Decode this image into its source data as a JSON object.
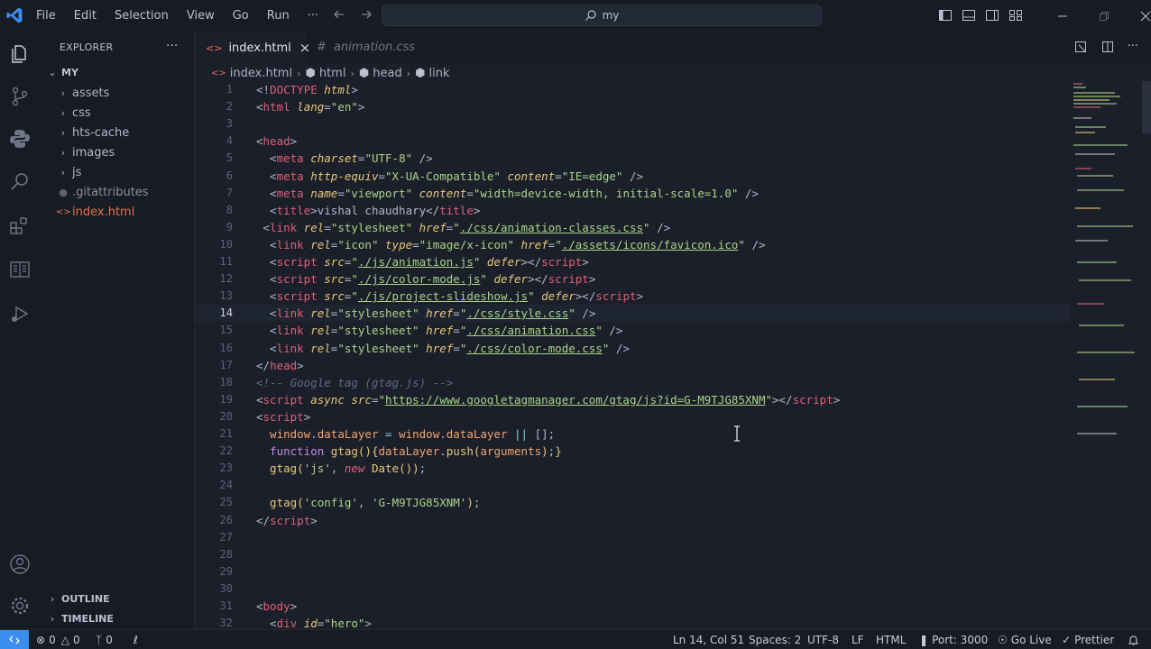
{
  "titlebar": {
    "menu": [
      "File",
      "Edit",
      "Selection",
      "View",
      "Go",
      "Run",
      "···"
    ],
    "search_text": "my"
  },
  "sidebar": {
    "title": "EXPLORER",
    "more": "···",
    "root": "MY",
    "items": [
      {
        "label": "assets",
        "type": "folder"
      },
      {
        "label": "css",
        "type": "folder"
      },
      {
        "label": "hts-cache",
        "type": "folder"
      },
      {
        "label": "images",
        "type": "folder"
      },
      {
        "label": "js",
        "type": "folder"
      },
      {
        "label": ".gitattributes",
        "type": "file"
      },
      {
        "label": "index.html",
        "type": "html"
      }
    ],
    "outline": "OUTLINE",
    "timeline": "TIMELINE"
  },
  "tabs": [
    {
      "label": "index.html",
      "icon": "html-icon",
      "active": true
    },
    {
      "label": "animation.css",
      "icon": "hash-icon",
      "active": false
    }
  ],
  "breadcrumb": [
    "index.html",
    "html",
    "head",
    "link"
  ],
  "editor": {
    "current_line": 14,
    "lines": [
      [
        [
          "t",
          "<!"
        ],
        [
          "tg",
          "DOCTYPE"
        ],
        [
          "t",
          " "
        ],
        [
          "at",
          "html"
        ],
        [
          "t",
          ">"
        ]
      ],
      [
        [
          "t",
          "<"
        ],
        [
          "tg",
          "html"
        ],
        [
          "t",
          " "
        ],
        [
          "at",
          "lang"
        ],
        [
          "t",
          "="
        ],
        [
          "sv",
          "\"en\""
        ],
        [
          "t",
          ">"
        ]
      ],
      [],
      [
        [
          "t",
          "<"
        ],
        [
          "tg",
          "head"
        ],
        [
          "t",
          ">"
        ]
      ],
      [
        [
          "t",
          "  <"
        ],
        [
          "tg",
          "meta"
        ],
        [
          "t",
          " "
        ],
        [
          "at",
          "charset"
        ],
        [
          "t",
          "="
        ],
        [
          "sv",
          "\"UTF-8\""
        ],
        [
          "t",
          " />"
        ]
      ],
      [
        [
          "t",
          "  <"
        ],
        [
          "tg",
          "meta"
        ],
        [
          "t",
          " "
        ],
        [
          "at",
          "http-equiv"
        ],
        [
          "t",
          "="
        ],
        [
          "sv",
          "\"X-UA-Compatible\""
        ],
        [
          "t",
          " "
        ],
        [
          "at",
          "content"
        ],
        [
          "t",
          "="
        ],
        [
          "sv",
          "\"IE=edge\""
        ],
        [
          "t",
          " />"
        ]
      ],
      [
        [
          "t",
          "  <"
        ],
        [
          "tg",
          "meta"
        ],
        [
          "t",
          " "
        ],
        [
          "at",
          "name"
        ],
        [
          "t",
          "="
        ],
        [
          "sv",
          "\"viewport\""
        ],
        [
          "t",
          " "
        ],
        [
          "at",
          "content"
        ],
        [
          "t",
          "="
        ],
        [
          "sv",
          "\"width=device-width, initial-scale=1.0\""
        ],
        [
          "t",
          " />"
        ]
      ],
      [
        [
          "t",
          "  <"
        ],
        [
          "tg",
          "title"
        ],
        [
          "t",
          ">vishal chaudhary</"
        ],
        [
          "tg",
          "title"
        ],
        [
          "t",
          ">"
        ]
      ],
      [
        [
          "t",
          " <"
        ],
        [
          "tg",
          "link"
        ],
        [
          "t",
          " "
        ],
        [
          "at",
          "rel"
        ],
        [
          "t",
          "="
        ],
        [
          "sv",
          "\"stylesheet\""
        ],
        [
          "t",
          " "
        ],
        [
          "at",
          "href"
        ],
        [
          "t",
          "="
        ],
        [
          "sv",
          "\""
        ],
        [
          "svu",
          "./css/animation-classes.css"
        ],
        [
          "sv",
          "\""
        ],
        [
          "t",
          " />"
        ]
      ],
      [
        [
          "t",
          "  <"
        ],
        [
          "tg",
          "link"
        ],
        [
          "t",
          " "
        ],
        [
          "at",
          "rel"
        ],
        [
          "t",
          "="
        ],
        [
          "sv",
          "\"icon\""
        ],
        [
          "t",
          " "
        ],
        [
          "at",
          "type"
        ],
        [
          "t",
          "="
        ],
        [
          "sv",
          "\"image/x-icon\""
        ],
        [
          "t",
          " "
        ],
        [
          "at",
          "href"
        ],
        [
          "t",
          "="
        ],
        [
          "sv",
          "\""
        ],
        [
          "svu",
          "./assets/icons/favicon.ico"
        ],
        [
          "sv",
          "\""
        ],
        [
          "t",
          " />"
        ]
      ],
      [
        [
          "t",
          "  <"
        ],
        [
          "tg",
          "script"
        ],
        [
          "t",
          " "
        ],
        [
          "at",
          "src"
        ],
        [
          "t",
          "="
        ],
        [
          "sv",
          "\""
        ],
        [
          "svu",
          "./js/animation.js"
        ],
        [
          "sv",
          "\""
        ],
        [
          "t",
          " "
        ],
        [
          "at",
          "defer"
        ],
        [
          "t",
          "></"
        ],
        [
          "tg",
          "script"
        ],
        [
          "t",
          ">"
        ]
      ],
      [
        [
          "t",
          "  <"
        ],
        [
          "tg",
          "script"
        ],
        [
          "t",
          " "
        ],
        [
          "at",
          "src"
        ],
        [
          "t",
          "="
        ],
        [
          "sv",
          "\""
        ],
        [
          "svu",
          "./js/color-mode.js"
        ],
        [
          "sv",
          "\""
        ],
        [
          "t",
          " "
        ],
        [
          "at",
          "defer"
        ],
        [
          "t",
          "></"
        ],
        [
          "tg",
          "script"
        ],
        [
          "t",
          ">"
        ]
      ],
      [
        [
          "t",
          "  <"
        ],
        [
          "tg",
          "script"
        ],
        [
          "t",
          " "
        ],
        [
          "at",
          "src"
        ],
        [
          "t",
          "="
        ],
        [
          "sv",
          "\""
        ],
        [
          "svu",
          "./js/project-slideshow.js"
        ],
        [
          "sv",
          "\""
        ],
        [
          "t",
          " "
        ],
        [
          "at",
          "defer"
        ],
        [
          "t",
          "></"
        ],
        [
          "tg",
          "script"
        ],
        [
          "t",
          ">"
        ]
      ],
      [
        [
          "t",
          "  <"
        ],
        [
          "tg",
          "link"
        ],
        [
          "t",
          " "
        ],
        [
          "at",
          "rel"
        ],
        [
          "t",
          "="
        ],
        [
          "sv",
          "\"stylesheet\""
        ],
        [
          "t",
          " "
        ],
        [
          "at",
          "href"
        ],
        [
          "t",
          "="
        ],
        [
          "sv",
          "\""
        ],
        [
          "svu",
          "./css/style.css"
        ],
        [
          "sv",
          "\""
        ],
        [
          "t",
          " />"
        ]
      ],
      [
        [
          "t",
          "  <"
        ],
        [
          "tg",
          "link"
        ],
        [
          "t",
          " "
        ],
        [
          "at",
          "rel"
        ],
        [
          "t",
          "="
        ],
        [
          "sv",
          "\"stylesheet\""
        ],
        [
          "t",
          " "
        ],
        [
          "at",
          "href"
        ],
        [
          "t",
          "="
        ],
        [
          "sv",
          "\""
        ],
        [
          "svu",
          "./css/animation.css"
        ],
        [
          "sv",
          "\""
        ],
        [
          "t",
          " />"
        ]
      ],
      [
        [
          "t",
          "  <"
        ],
        [
          "tg",
          "link"
        ],
        [
          "t",
          " "
        ],
        [
          "at",
          "rel"
        ],
        [
          "t",
          "="
        ],
        [
          "sv",
          "\"stylesheet\""
        ],
        [
          "t",
          " "
        ],
        [
          "at",
          "href"
        ],
        [
          "t",
          "="
        ],
        [
          "sv",
          "\""
        ],
        [
          "svu",
          "./css/color-mode.css"
        ],
        [
          "sv",
          "\""
        ],
        [
          "t",
          " />"
        ]
      ],
      [
        [
          "t",
          "</"
        ],
        [
          "tg",
          "head"
        ],
        [
          "t",
          ">"
        ]
      ],
      [
        [
          "cm",
          "<!-- Google tag (gtag.js) -->"
        ]
      ],
      [
        [
          "t",
          "<"
        ],
        [
          "tg",
          "script"
        ],
        [
          "t",
          " "
        ],
        [
          "at",
          "async"
        ],
        [
          "t",
          " "
        ],
        [
          "at",
          "src"
        ],
        [
          "t",
          "="
        ],
        [
          "sv",
          "\""
        ],
        [
          "svu",
          "https://www.googletagmanager.com/gtag/js?id=G-M9TJG85XNM"
        ],
        [
          "sv",
          "\""
        ],
        [
          "t",
          "></"
        ],
        [
          "tg",
          "script"
        ],
        [
          "t",
          ">"
        ]
      ],
      [
        [
          "t",
          "<"
        ],
        [
          "tg",
          "script"
        ],
        [
          "t",
          ">"
        ]
      ],
      [
        [
          "vr",
          "  window"
        ],
        [
          "t",
          "."
        ],
        [
          "vr",
          "dataLayer"
        ],
        [
          "op",
          " = "
        ],
        [
          "vr",
          "window"
        ],
        [
          "t",
          "."
        ],
        [
          "vr",
          "dataLayer"
        ],
        [
          "op",
          " || "
        ],
        [
          "t",
          "[];"
        ]
      ],
      [
        [
          "kw",
          "  function"
        ],
        [
          "t",
          " "
        ],
        [
          "fn",
          "gtag"
        ],
        [
          "br",
          "()"
        ],
        [
          "br",
          "{"
        ],
        [
          "vr",
          "dataLayer"
        ],
        [
          "t",
          "."
        ],
        [
          "fn",
          "push"
        ],
        [
          "br",
          "("
        ],
        [
          "vr",
          "arguments"
        ],
        [
          "br",
          ")"
        ],
        [
          "t",
          ";"
        ],
        [
          "br",
          "}"
        ]
      ],
      [
        [
          "fn",
          "  gtag"
        ],
        [
          "br",
          "("
        ],
        [
          "sv",
          "'js'"
        ],
        [
          "t",
          ", "
        ],
        [
          "nw",
          "new"
        ],
        [
          "t",
          " "
        ],
        [
          "fn",
          "Date"
        ],
        [
          "br",
          "()"
        ],
        [
          "br",
          ")"
        ],
        [
          "t",
          ";"
        ]
      ],
      [],
      [
        [
          "fn",
          "  gtag"
        ],
        [
          "br",
          "("
        ],
        [
          "sv",
          "'config'"
        ],
        [
          "t",
          ", "
        ],
        [
          "sv",
          "'G-M9TJG85XNM'"
        ],
        [
          "br",
          ")"
        ],
        [
          "t",
          ";"
        ]
      ],
      [
        [
          "t",
          "</"
        ],
        [
          "tg",
          "script"
        ],
        [
          "t",
          ">"
        ]
      ],
      [],
      [],
      [],
      [],
      [
        [
          "t",
          "<"
        ],
        [
          "tg",
          "body"
        ],
        [
          "t",
          ">"
        ]
      ],
      [
        [
          "t",
          "  <"
        ],
        [
          "tg",
          "div"
        ],
        [
          "t",
          " "
        ],
        [
          "at",
          "id"
        ],
        [
          "t",
          "="
        ],
        [
          "sv",
          "\"hero\""
        ],
        [
          "t",
          ">"
        ]
      ]
    ]
  },
  "statusbar": {
    "errors": "0",
    "warnings": "0",
    "ports": "0",
    "position": "Ln 14, Col 51",
    "spaces": "Spaces: 2",
    "encoding": "UTF-8",
    "eol": "LF",
    "language": "HTML",
    "port": "Port: 3000",
    "golive": "Go Live",
    "prettier": "Prettier"
  },
  "colors": {
    "accent": "#3a8ef0",
    "tag": "#e05f77",
    "attribute": "#e8c876",
    "string": "#aad488",
    "html_icon": "#e8734c"
  }
}
